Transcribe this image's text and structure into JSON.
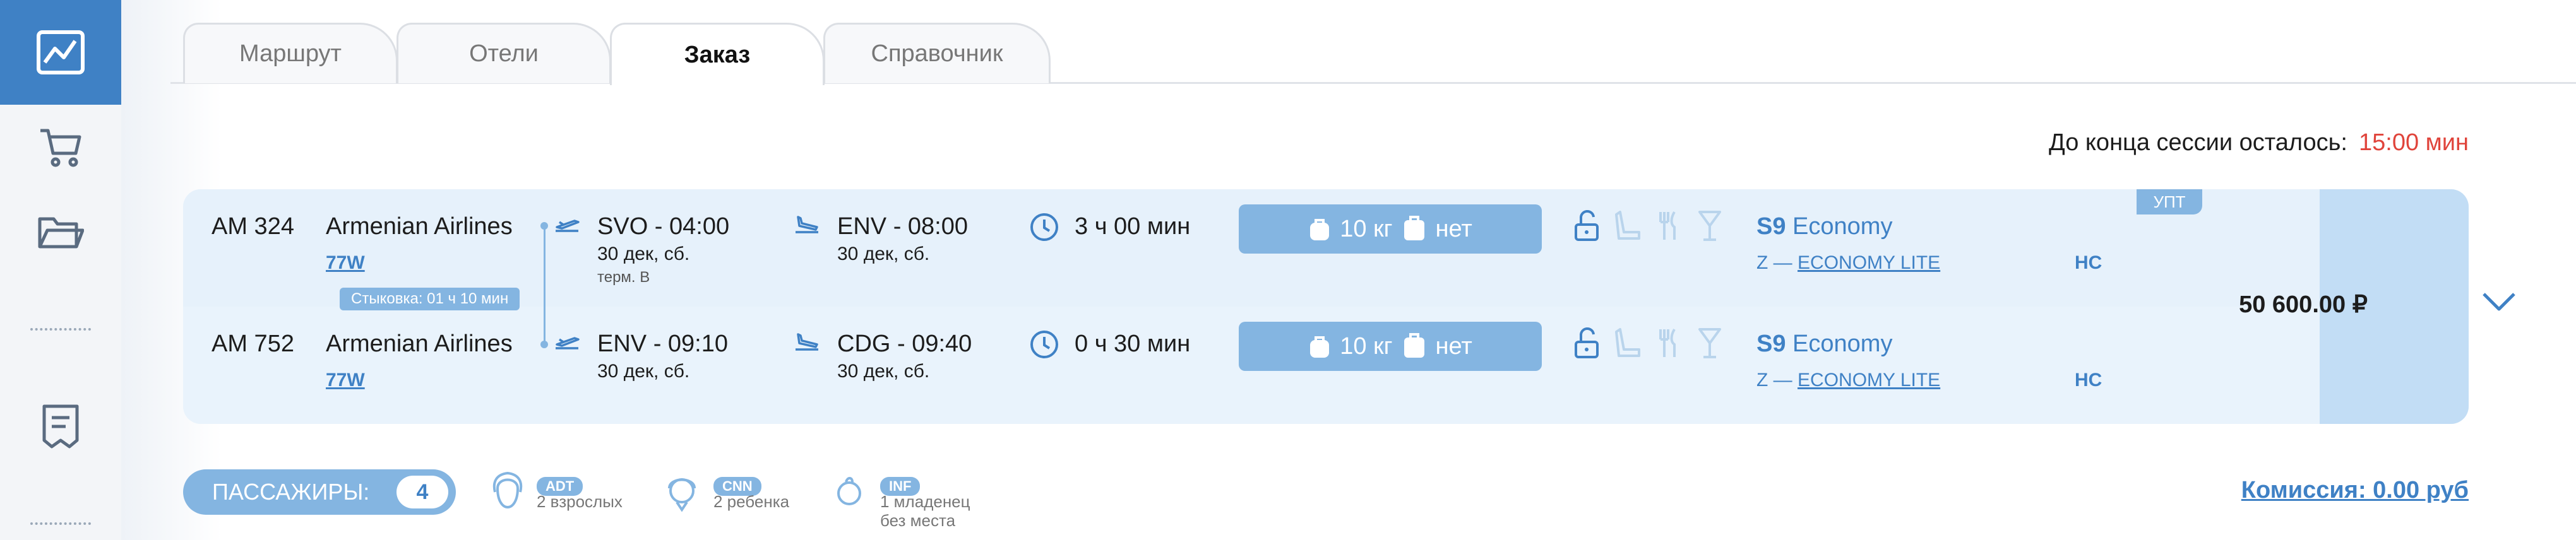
{
  "tabs": [
    "Маршрут",
    "Отели",
    "Заказ",
    "Справочник"
  ],
  "session": {
    "label": "До конца сессии осталось:",
    "time": "15:00 мин"
  },
  "segments": [
    {
      "flight": "AM 324",
      "airline": "Armenian Airlines",
      "code": "77W",
      "dep": {
        "route": "SVO  -  04:00",
        "date": "30 дек, сб.",
        "terminal": "терм.  В"
      },
      "arr": {
        "route": "ENV  -  08:00",
        "date": "30 дек, сб."
      },
      "duration": "3 ч 00 мин",
      "bag": {
        "weight": "10 кг",
        "hand": "нет"
      },
      "cls": "S9",
      "cabin": "Economy",
      "fare_prefix": "Z —",
      "fare": "ECONOMY LITE",
      "ns": "НС"
    },
    {
      "flight": "AM 752",
      "airline": "Armenian Airlines",
      "code": "77W",
      "dep": {
        "route": "ENV  -  09:10",
        "date": "30 дек, сб."
      },
      "arr": {
        "route": "CDG  -  09:40",
        "date": "30 дек, сб."
      },
      "duration": "0 ч 30 мин",
      "bag": {
        "weight": "10 кг",
        "hand": "нет"
      },
      "cls": "S9",
      "cabin": "Economy",
      "fare_prefix": "Z —",
      "fare": "ECONOMY LITE",
      "ns": "НС"
    }
  ],
  "connection": "Стыковка: 01 ч 10 мин",
  "badge": "УПТ",
  "price": "50 600.00 ₽",
  "passengers": {
    "label": "ПАССАЖИРЫ:",
    "count": "4",
    "types": [
      {
        "code": "ADT",
        "desc1": "2 взрослых",
        "desc2": ""
      },
      {
        "code": "CNN",
        "desc1": "2 ребенка",
        "desc2": ""
      },
      {
        "code": "INF",
        "desc1": "1 младенец",
        "desc2": "без места"
      }
    ]
  },
  "commission": "Комиссия:  0.00 руб",
  "colors": {
    "accent": "#3f81c5",
    "light": "#84b5e1",
    "timer": "#e0443b"
  },
  "icons": [
    "chart-icon",
    "cart-icon",
    "folder-icon",
    "receipt-icon"
  ]
}
